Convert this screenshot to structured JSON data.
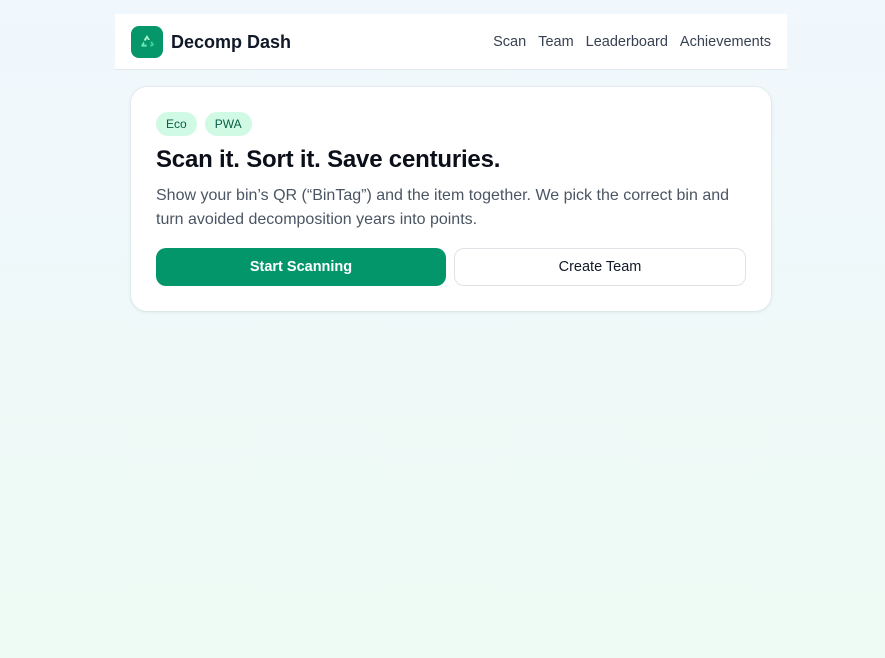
{
  "header": {
    "brand": "Decomp Dash",
    "logo_icon": "recycle-icon",
    "nav": [
      {
        "label": "Scan"
      },
      {
        "label": "Team"
      },
      {
        "label": "Leaderboard"
      },
      {
        "label": "Achievements"
      }
    ]
  },
  "hero": {
    "badges": [
      "Eco",
      "PWA"
    ],
    "headline": "Scan it. Sort it. Save centuries.",
    "description": "Show your bin’s QR (“BinTag”) and the item together. We pick the correct bin and turn avoided decomposition years into points.",
    "primary_button": "Start Scanning",
    "secondary_button": "Create Team"
  },
  "colors": {
    "accent": "#059669",
    "badge_bg": "#d1fae5",
    "badge_text": "#065f46"
  }
}
